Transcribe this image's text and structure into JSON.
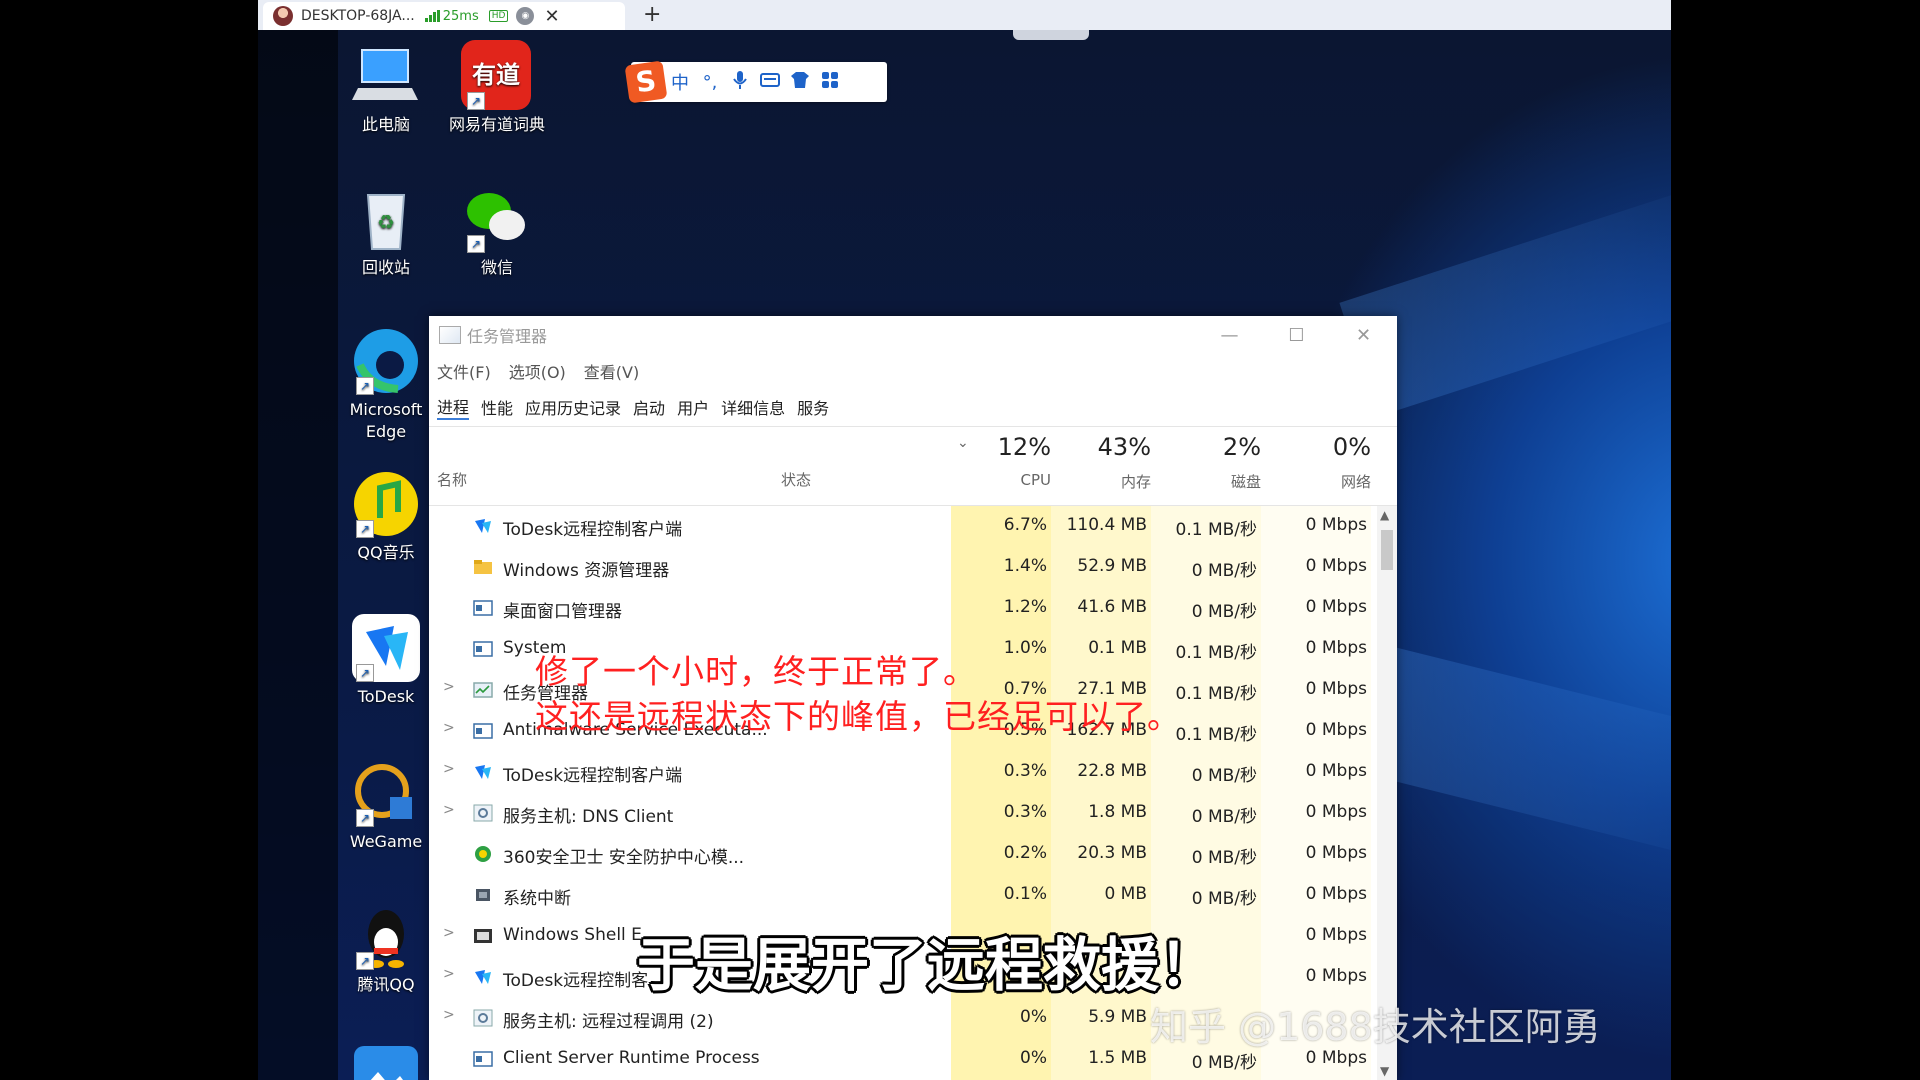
{
  "remote_tab": {
    "title": "DESKTOP-68JA...",
    "latency": "25ms",
    "quality_badge": "HD",
    "add_label": "+",
    "close_label": "✕"
  },
  "desktop_icons": [
    {
      "label": "此电脑",
      "icon": "computer-icon"
    },
    {
      "label": "网易有道词典",
      "icon": "youdao-icon",
      "badge": "有道"
    },
    {
      "label": "回收站",
      "icon": "recycle-bin-icon"
    },
    {
      "label": "微信",
      "icon": "wechat-icon"
    },
    {
      "label": "Microsoft Edge",
      "icon": "edge-icon"
    },
    {
      "label": "QQ音乐",
      "icon": "qq-music-icon"
    },
    {
      "label": "ToDesk",
      "icon": "todesk-icon"
    },
    {
      "label": "WeGame",
      "icon": "wegame-icon"
    },
    {
      "label": "腾讯QQ",
      "icon": "qq-icon"
    }
  ],
  "ime_toolbar": {
    "logo": "S",
    "items": [
      "中",
      "°,",
      "🎤",
      "▦",
      "👕",
      "▦"
    ]
  },
  "task_manager": {
    "title": "任务管理器",
    "window_buttons": [
      "—",
      "☐",
      "✕"
    ],
    "menu": [
      "文件(F)",
      "选项(O)",
      "查看(V)"
    ],
    "tabs": [
      "进程",
      "性能",
      "应用历史记录",
      "启动",
      "用户",
      "详细信息",
      "服务"
    ],
    "header": {
      "name": "名称",
      "status": "状态",
      "sort_indicator": "⌄",
      "cpu_pct": "12%",
      "cpu_label": "CPU",
      "mem_pct": "43%",
      "mem_label": "内存",
      "disk_pct": "2%",
      "disk_label": "磁盘",
      "net_pct": "0%",
      "net_label": "网络"
    },
    "rows": [
      {
        "expand": "",
        "name": "ToDesk远程控制客户端",
        "cpu": "6.7%",
        "mem": "110.4 MB",
        "disk": "0.1 MB/秒",
        "net": "0 Mbps",
        "icon": "todesk"
      },
      {
        "expand": "",
        "name": "Windows 资源管理器",
        "cpu": "1.4%",
        "mem": "52.9 MB",
        "disk": "0 MB/秒",
        "net": "0 Mbps",
        "icon": "folder"
      },
      {
        "expand": "",
        "name": "桌面窗口管理器",
        "cpu": "1.2%",
        "mem": "41.6 MB",
        "disk": "0 MB/秒",
        "net": "0 Mbps",
        "icon": "window"
      },
      {
        "expand": "",
        "name": "System",
        "cpu": "1.0%",
        "mem": "0.1 MB",
        "disk": "0.1 MB/秒",
        "net": "0 Mbps",
        "icon": "window"
      },
      {
        "expand": ">",
        "name": "任务管理器",
        "cpu": "0.7%",
        "mem": "27.1 MB",
        "disk": "0.1 MB/秒",
        "net": "0 Mbps",
        "icon": "taskmgr"
      },
      {
        "expand": ">",
        "name": "Antimalware Service Executa...",
        "cpu": "0.5%",
        "mem": "162.7 MB",
        "disk": "0.1 MB/秒",
        "net": "0 Mbps",
        "icon": "window"
      },
      {
        "expand": ">",
        "name": "ToDesk远程控制客户端",
        "cpu": "0.3%",
        "mem": "22.8 MB",
        "disk": "0 MB/秒",
        "net": "0 Mbps",
        "icon": "todesk"
      },
      {
        "expand": ">",
        "name": "服务主机: DNS Client",
        "cpu": "0.3%",
        "mem": "1.8 MB",
        "disk": "0 MB/秒",
        "net": "0 Mbps",
        "icon": "gear"
      },
      {
        "expand": "",
        "name": "360安全卫士 安全防护中心模...",
        "cpu": "0.2%",
        "mem": "20.3 MB",
        "disk": "0 MB/秒",
        "net": "0 Mbps",
        "icon": "360"
      },
      {
        "expand": "",
        "name": "系统中断",
        "cpu": "0.1%",
        "mem": "0 MB",
        "disk": "0 MB/秒",
        "net": "0 Mbps",
        "icon": "chip"
      },
      {
        "expand": ">",
        "name": "Windows Shell E...",
        "cpu": "",
        "mem": "",
        "disk": "",
        "net": "0 Mbps",
        "icon": "shell"
      },
      {
        "expand": ">",
        "name": "ToDesk远程控制客",
        "cpu": "",
        "mem": "",
        "disk": "",
        "net": "0 Mbps",
        "icon": "todesk"
      },
      {
        "expand": ">",
        "name": "服务主机: 远程过程调用 (2)",
        "cpu": "0%",
        "mem": "5.9 MB",
        "disk": "",
        "net": "",
        "icon": "gear"
      },
      {
        "expand": "",
        "name": "Client Server Runtime Process",
        "cpu": "0%",
        "mem": "1.5 MB",
        "disk": "0 MB/秒",
        "net": "0 Mbps",
        "icon": "window"
      }
    ]
  },
  "annotations": {
    "line1": "修了一个小时，终于正常了。",
    "line2": "这还是远程状态下的峰值，已经足可以了。"
  },
  "subtitle": "于是展开了远程救援！",
  "watermark": "知乎 @1688技术社区阿勇",
  "colors": {
    "cpu_heat": "#fff4b0",
    "mem_heat": "#fff8cc",
    "disk_heat": "#fffbe3",
    "annotation": "#ff2020"
  }
}
